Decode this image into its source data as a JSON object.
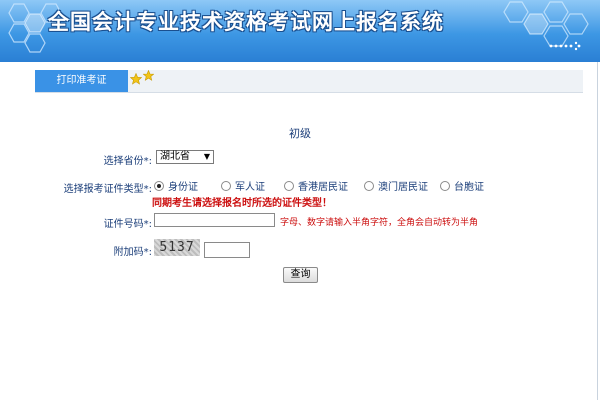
{
  "header": {
    "title": "全国会计专业技术资格考试网上报名系统"
  },
  "tabs": {
    "print_admission": "打印准考证"
  },
  "form": {
    "level": "初级",
    "province_label": "选择省份*:",
    "province_value": "湖北省",
    "id_type_label": "选择报考证件类型*:",
    "id_types": [
      {
        "label": "身份证",
        "checked": true
      },
      {
        "label": "军人证",
        "checked": false
      },
      {
        "label": "香港居民证",
        "checked": false
      },
      {
        "label": "澳门居民证",
        "checked": false
      },
      {
        "label": "台胞证",
        "checked": false
      }
    ],
    "id_type_warning": "同期考生请选择报名时所选的证件类型！",
    "id_number_label": "证件号码*:",
    "id_number_value": "",
    "id_number_hint": "字母、数字请输入半角字符，全角会自动转为半角",
    "captcha_label": "附加码*:",
    "captcha_text": "5137",
    "captcha_value": "",
    "query_button": "查询"
  },
  "colors": {
    "banner_blue": "#3d97e4",
    "tab_blue": "#3a92e6",
    "label_text": "#1c3f7a",
    "warning_red": "#cc1010"
  }
}
